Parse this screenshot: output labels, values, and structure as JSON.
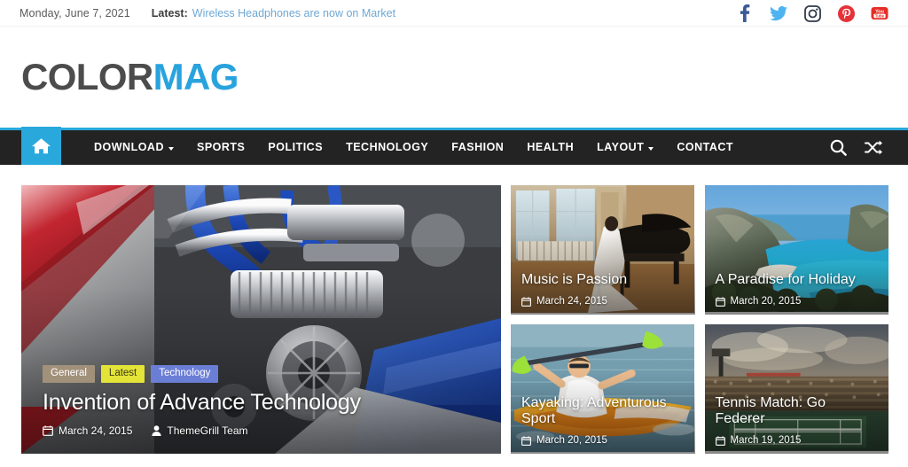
{
  "topbar": {
    "date": "Monday, June 7, 2021",
    "latest_label": "Latest:",
    "latest_link": "Wireless Headphones are now on Market",
    "social": [
      {
        "name": "facebook-icon",
        "color": "#3b5998"
      },
      {
        "name": "twitter-icon",
        "color": "#4eb4f0"
      },
      {
        "name": "instagram-icon",
        "color": "#2f3a4a"
      },
      {
        "name": "pinterest-icon",
        "color": "#e53238"
      },
      {
        "name": "youtube-icon",
        "color": "#e52d27"
      }
    ]
  },
  "logo": {
    "part1": "COLOR",
    "part2": "MAG",
    "part1_color": "#4c4c4c",
    "part2_color": "#28a3dd"
  },
  "nav": {
    "accent_color": "#29a8dc",
    "bar_color": "#232323",
    "home_icon": "home-icon",
    "items": [
      {
        "label": "DOWNLOAD",
        "has_caret": true
      },
      {
        "label": "SPORTS",
        "has_caret": false
      },
      {
        "label": "POLITICS",
        "has_caret": false
      },
      {
        "label": "TECHNOLOGY",
        "has_caret": false
      },
      {
        "label": "FASHION",
        "has_caret": false
      },
      {
        "label": "HEALTH",
        "has_caret": false
      },
      {
        "label": "LAYOUT",
        "has_caret": true
      },
      {
        "label": "CONTACT",
        "has_caret": false
      }
    ],
    "right_icons": [
      {
        "name": "search-icon"
      },
      {
        "name": "random-post-icon"
      }
    ]
  },
  "feature": {
    "main": {
      "title": "Invention of Advance Technology",
      "date": "March 24, 2015",
      "author": "ThemeGrill Team",
      "image_alt": "car-engine-photo",
      "badges": [
        {
          "label": "General",
          "color": "#a2917a"
        },
        {
          "label": "Latest",
          "color": "#e4e438",
          "text_color": "#3a3a1a"
        },
        {
          "label": "Technology",
          "color": "#6b7ed6"
        }
      ]
    },
    "cards": [
      {
        "title": "Music is Passion",
        "date": "March 24, 2015",
        "image_alt": "woman-at-grand-piano-photo"
      },
      {
        "title": "A Paradise for Holiday",
        "date": "March 20, 2015",
        "image_alt": "navagio-beach-cove-photo"
      },
      {
        "title": "Kayaking: Adventurous Sport",
        "date": "March 20, 2015",
        "image_alt": "kayaker-on-water-photo"
      },
      {
        "title": "Tennis Match: Go Federer",
        "date": "March 19, 2015",
        "image_alt": "tennis-stadium-photo"
      }
    ]
  }
}
